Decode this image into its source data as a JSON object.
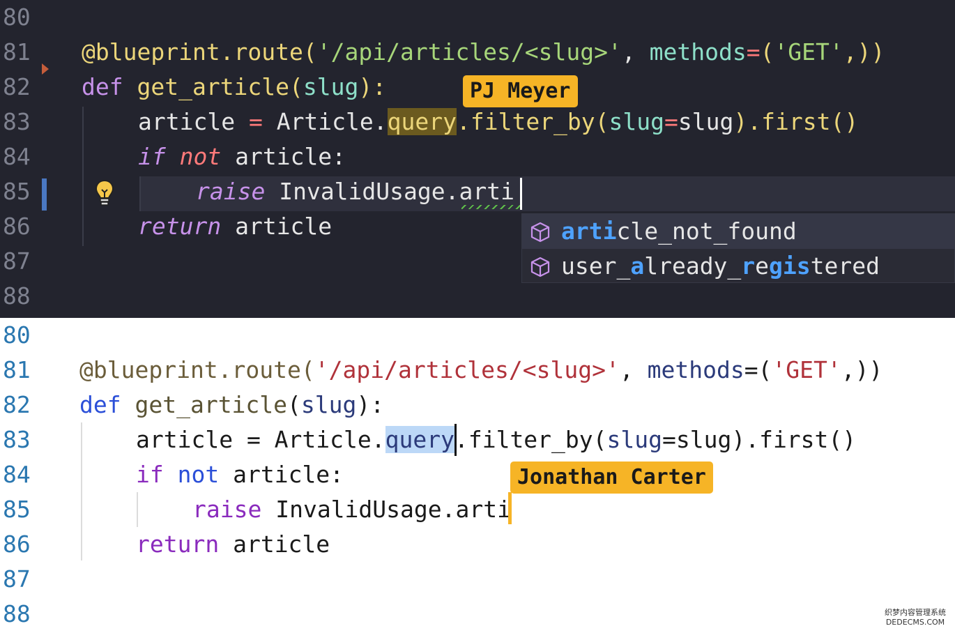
{
  "dark_editor": {
    "line_numbers": [
      "80",
      "81",
      "82",
      "83",
      "84",
      "85",
      "86",
      "87",
      "88"
    ],
    "line81": {
      "decorator": "@blueprint.route(",
      "string": "'/api/articles/<slug>'",
      "comma": ", ",
      "kwarg": "methods",
      "eq": "=",
      "open": "(",
      "string2": "'GET'",
      "close": ",))"
    },
    "line82": {
      "kw": "def ",
      "fn": "get_article",
      "open": "(",
      "param": "slug",
      "close": "):"
    },
    "line83": {
      "lhs": "article ",
      "eq": "=",
      "mid": " Article.",
      "query": "query",
      "method": ".filter_by",
      "open": "(",
      "kwarg": "slug",
      "eq2": "=",
      "arg": "slug",
      "close": ").first()"
    },
    "line84": {
      "kw_if": "if",
      "kw_not": "not",
      "rest": " article:"
    },
    "line85": {
      "kw": "raise",
      "rest": " InvalidUsage.arti"
    },
    "line86": {
      "kw": "return",
      "rest": " article"
    },
    "collaborator_tag": "PJ Meyer",
    "suggestions": [
      {
        "pre": "",
        "m1": "arti",
        "post": "cle_not_found",
        "icon": "cube-icon"
      },
      {
        "pre": "user_",
        "m1": "a",
        "mid": "lready_",
        "m2": "r",
        "post2": "e",
        "m3": "gis",
        "tail": "tered",
        "icon": "cube-icon"
      }
    ]
  },
  "light_editor": {
    "line_numbers": [
      "80",
      "81",
      "82",
      "83",
      "84",
      "85",
      "86",
      "87",
      "88"
    ],
    "line81": {
      "decorator": "@blueprint.route(",
      "string": "'/api/articles/<slug>'",
      "comma": ", ",
      "kwarg": "methods",
      "eq": "=(",
      "string2": "'GET'",
      "close": ",))"
    },
    "line82": {
      "kw": "def ",
      "fn": "get_article",
      "open": "(",
      "param": "slug",
      "close": "):"
    },
    "line83": {
      "lhs": "article = Article.",
      "query": "query",
      "rest": ".filter_by(",
      "kwarg": "slug",
      "rest2": "=slug).first()"
    },
    "line84": {
      "kw_if": "if",
      "kw_not": "not",
      "rest": " article:"
    },
    "line85": {
      "kw": "raise",
      "rest": " InvalidUsage.arti"
    },
    "line86": {
      "kw": "return",
      "rest": " article"
    },
    "collaborator_tag": "Jonathan Carter"
  },
  "watermark": {
    "line1": "织梦内容管理系统",
    "line2": "DEDECMS.COM"
  },
  "colors": {
    "dark_bg": "#23242e",
    "tag_bg": "#f6b426",
    "match_blue": "#4ea2ff",
    "selection_light": "#bcd8f7"
  }
}
